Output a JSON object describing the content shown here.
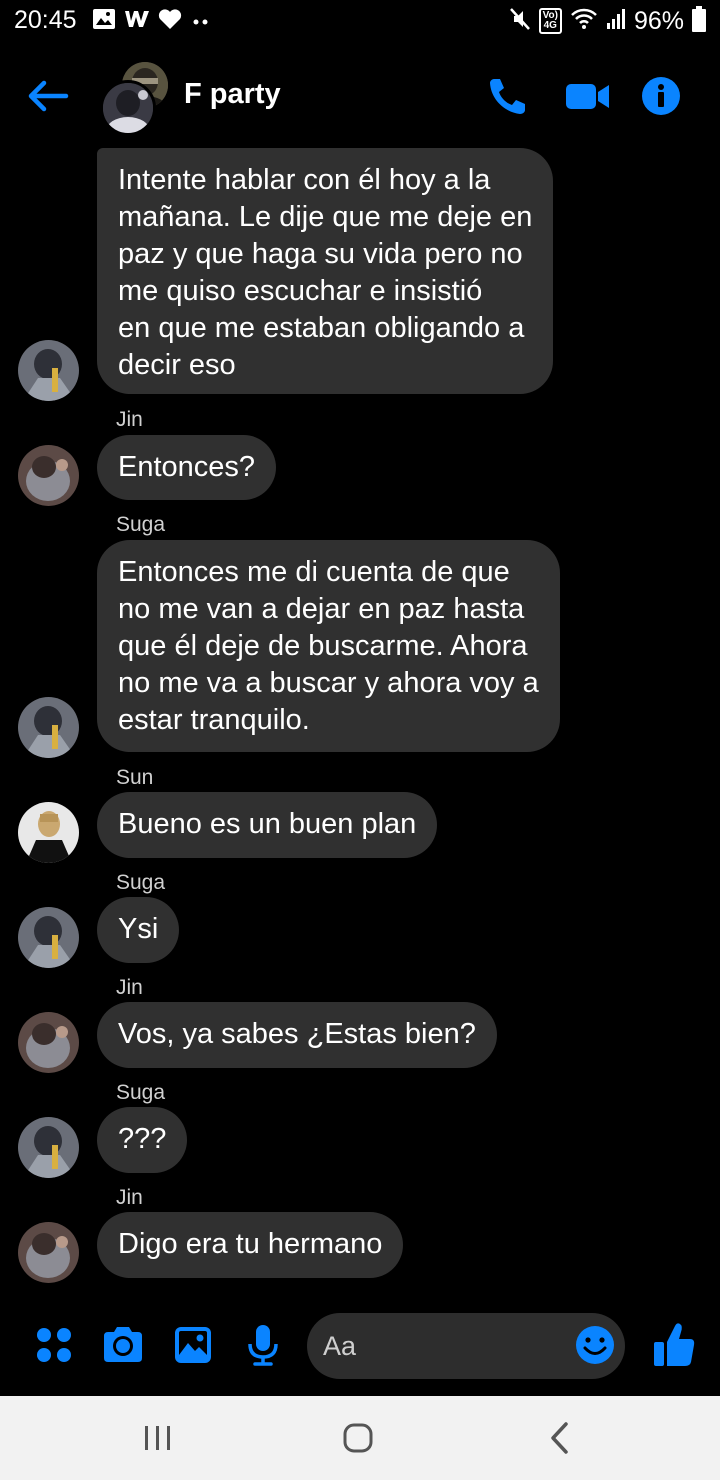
{
  "status_bar": {
    "time": "20:45",
    "battery": "96%",
    "volte_label": "Vo)\n4G",
    "left_icons": [
      "image-icon",
      "w-app-icon",
      "heart-icon",
      "more-dots-icon"
    ],
    "right_icons": [
      "mute-icon",
      "volte-icon",
      "wifi-icon",
      "signal-icon",
      "battery-icon"
    ]
  },
  "header": {
    "title": "F party",
    "accent": "#0a84ff",
    "icons": [
      "back-arrow-icon",
      "phone-icon",
      "video-icon",
      "info-icon"
    ]
  },
  "messages": [
    {
      "sender": "",
      "text_lines": [
        "Intente hablar con él hoy a la",
        "mañana. Le dije que me deje en",
        "paz y que haga su vida pero no",
        "me quiso escuchar e insistió",
        "en que me estaban obligando a",
        "decir eso"
      ]
    },
    {
      "sender": "Jin",
      "text_lines": [
        "Entonces?"
      ]
    },
    {
      "sender": "Suga",
      "text_lines": [
        "Entonces me di cuenta de que",
        "no me van a dejar en paz hasta",
        "que él deje de buscarme. Ahora",
        "no me va a buscar y ahora voy a",
        "estar tranquilo."
      ]
    },
    {
      "sender": "Sun",
      "text_lines": [
        "Bueno es un buen plan"
      ]
    },
    {
      "sender": "Suga",
      "text_lines": [
        "Ysi"
      ]
    },
    {
      "sender": "Jin",
      "text_lines": [
        "Vos, ya sabes ¿Estas bien?"
      ]
    },
    {
      "sender": "Suga",
      "text_lines": [
        "???"
      ]
    },
    {
      "sender": "Jin",
      "text_lines": [
        "Digo era tu hermano"
      ]
    }
  ],
  "composer": {
    "placeholder": "Aa",
    "icons": [
      "apps-grid-icon",
      "camera-icon",
      "gallery-icon",
      "microphone-icon",
      "emoji-icon",
      "thumbs-up-icon"
    ]
  },
  "nav_bar": {
    "icons": [
      "recent-apps-icon",
      "home-icon",
      "back-icon"
    ]
  },
  "colors": {
    "background": "#000000",
    "bubble": "#303030",
    "accent": "#0a84ff",
    "nav_bar": "#f2f2f2"
  }
}
